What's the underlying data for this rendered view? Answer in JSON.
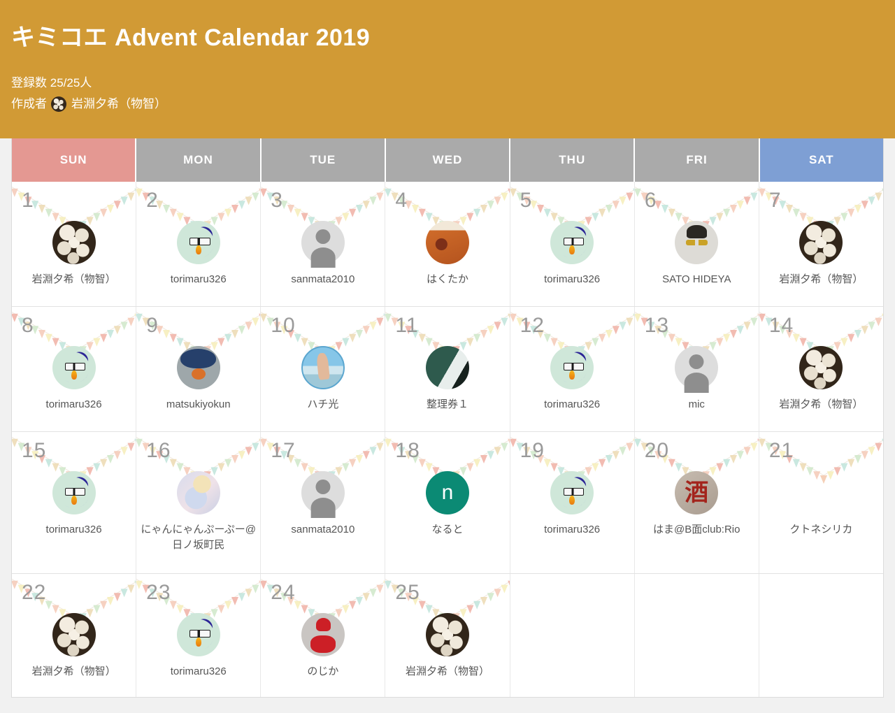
{
  "header": {
    "title": "キミコエ Advent Calendar 2019",
    "registration_label": "登録数",
    "registration_value": "25/25人",
    "creator_label": "作成者",
    "creator_name": "岩淵夕希（物智）",
    "creator_avatar": "cracked-egg-avatar-icon",
    "background_color": "#d19a35",
    "text_color": "#ffffff"
  },
  "calendar": {
    "weekdays": [
      {
        "label": "SUN",
        "kind": "sun",
        "color": "#e49892"
      },
      {
        "label": "MON",
        "kind": "weekday",
        "color": "#aaaaaa"
      },
      {
        "label": "TUE",
        "kind": "weekday",
        "color": "#aaaaaa"
      },
      {
        "label": "WED",
        "kind": "weekday",
        "color": "#aaaaaa"
      },
      {
        "label": "THU",
        "kind": "weekday",
        "color": "#aaaaaa"
      },
      {
        "label": "FRI",
        "kind": "weekday",
        "color": "#aaaaaa"
      },
      {
        "label": "SAT",
        "kind": "sat",
        "color": "#7e9fd4"
      }
    ],
    "bunting_colors": [
      "#cfe7c9",
      "#f4c9b6",
      "#f6edb8",
      "#f0b0a4",
      "#bfe4da",
      "#ecd9b2"
    ],
    "day_number_color": "#9a9a9a",
    "entry_name_color": "#555555",
    "weeks": [
      [
        {
          "day": "1",
          "name": "岩淵夕希（物智）",
          "avatar": "av-cracked",
          "avatar_name": "avatar-iwabuchi-yuki"
        },
        {
          "day": "2",
          "name": "torimaru326",
          "avatar": "av-bird",
          "avatar_name": "avatar-torimaru326"
        },
        {
          "day": "3",
          "name": "sanmata2010",
          "avatar": "av-default",
          "avatar_name": "avatar-default-person"
        },
        {
          "day": "4",
          "name": "はくたか",
          "avatar": "av-beer",
          "avatar_name": "avatar-hakutaka"
        },
        {
          "day": "5",
          "name": "torimaru326",
          "avatar": "av-bird",
          "avatar_name": "avatar-torimaru326"
        },
        {
          "day": "6",
          "name": "SATO HIDEYA",
          "avatar": "av-sketch",
          "avatar_name": "avatar-sato-hideya"
        },
        {
          "day": "7",
          "name": "岩淵夕希（物智）",
          "avatar": "av-cracked",
          "avatar_name": "avatar-iwabuchi-yuki"
        }
      ],
      [
        {
          "day": "8",
          "name": "torimaru326",
          "avatar": "av-bird",
          "avatar_name": "avatar-torimaru326"
        },
        {
          "day": "9",
          "name": "matsukiyokun",
          "avatar": "av-penguin",
          "avatar_name": "avatar-matsukiyokun"
        },
        {
          "day": "10",
          "name": "ハチ光",
          "avatar": "av-hands",
          "avatar_name": "avatar-hachiko"
        },
        {
          "day": "11",
          "name": "整理券１",
          "avatar": "av-statue",
          "avatar_name": "avatar-seirikenn1"
        },
        {
          "day": "12",
          "name": "torimaru326",
          "avatar": "av-bird",
          "avatar_name": "avatar-torimaru326"
        },
        {
          "day": "13",
          "name": "mic",
          "avatar": "av-default",
          "avatar_name": "avatar-default-person"
        },
        {
          "day": "14",
          "name": "岩淵夕希（物智）",
          "avatar": "av-cracked",
          "avatar_name": "avatar-iwabuchi-yuki"
        }
      ],
      [
        {
          "day": "15",
          "name": "torimaru326",
          "avatar": "av-bird",
          "avatar_name": "avatar-torimaru326"
        },
        {
          "day": "16",
          "name": "にゃんにゃんぷーぷー@日ノ坂町民",
          "avatar": "av-anime",
          "avatar_name": "avatar-nyannyanpupu"
        },
        {
          "day": "17",
          "name": "sanmata2010",
          "avatar": "av-default",
          "avatar_name": "avatar-default-person"
        },
        {
          "day": "18",
          "name": "なると",
          "avatar": "av-letter",
          "avatar_name": "avatar-naruto",
          "letter": "n"
        },
        {
          "day": "19",
          "name": "torimaru326",
          "avatar": "av-bird",
          "avatar_name": "avatar-torimaru326"
        },
        {
          "day": "20",
          "name": "はま@B面club:Rio",
          "avatar": "av-kanji",
          "avatar_name": "avatar-hama",
          "letter": "酒"
        },
        {
          "day": "21",
          "name": "クトネシリカ",
          "avatar": "av-figure",
          "avatar_name": "avatar-kutonesirika"
        }
      ],
      [
        {
          "day": "22",
          "name": "岩淵夕希（物智）",
          "avatar": "av-cracked",
          "avatar_name": "avatar-iwabuchi-yuki"
        },
        {
          "day": "23",
          "name": "torimaru326",
          "avatar": "av-bird",
          "avatar_name": "avatar-torimaru326"
        },
        {
          "day": "24",
          "name": "のじか",
          "avatar": "av-santa",
          "avatar_name": "avatar-nojika"
        },
        {
          "day": "25",
          "name": "岩淵夕希（物智）",
          "avatar": "av-cracked",
          "avatar_name": "avatar-iwabuchi-yuki"
        },
        {
          "day": "",
          "name": "",
          "avatar": "",
          "avatar_name": ""
        },
        {
          "day": "",
          "name": "",
          "avatar": "",
          "avatar_name": ""
        },
        {
          "day": "",
          "name": "",
          "avatar": "",
          "avatar_name": ""
        }
      ]
    ]
  }
}
